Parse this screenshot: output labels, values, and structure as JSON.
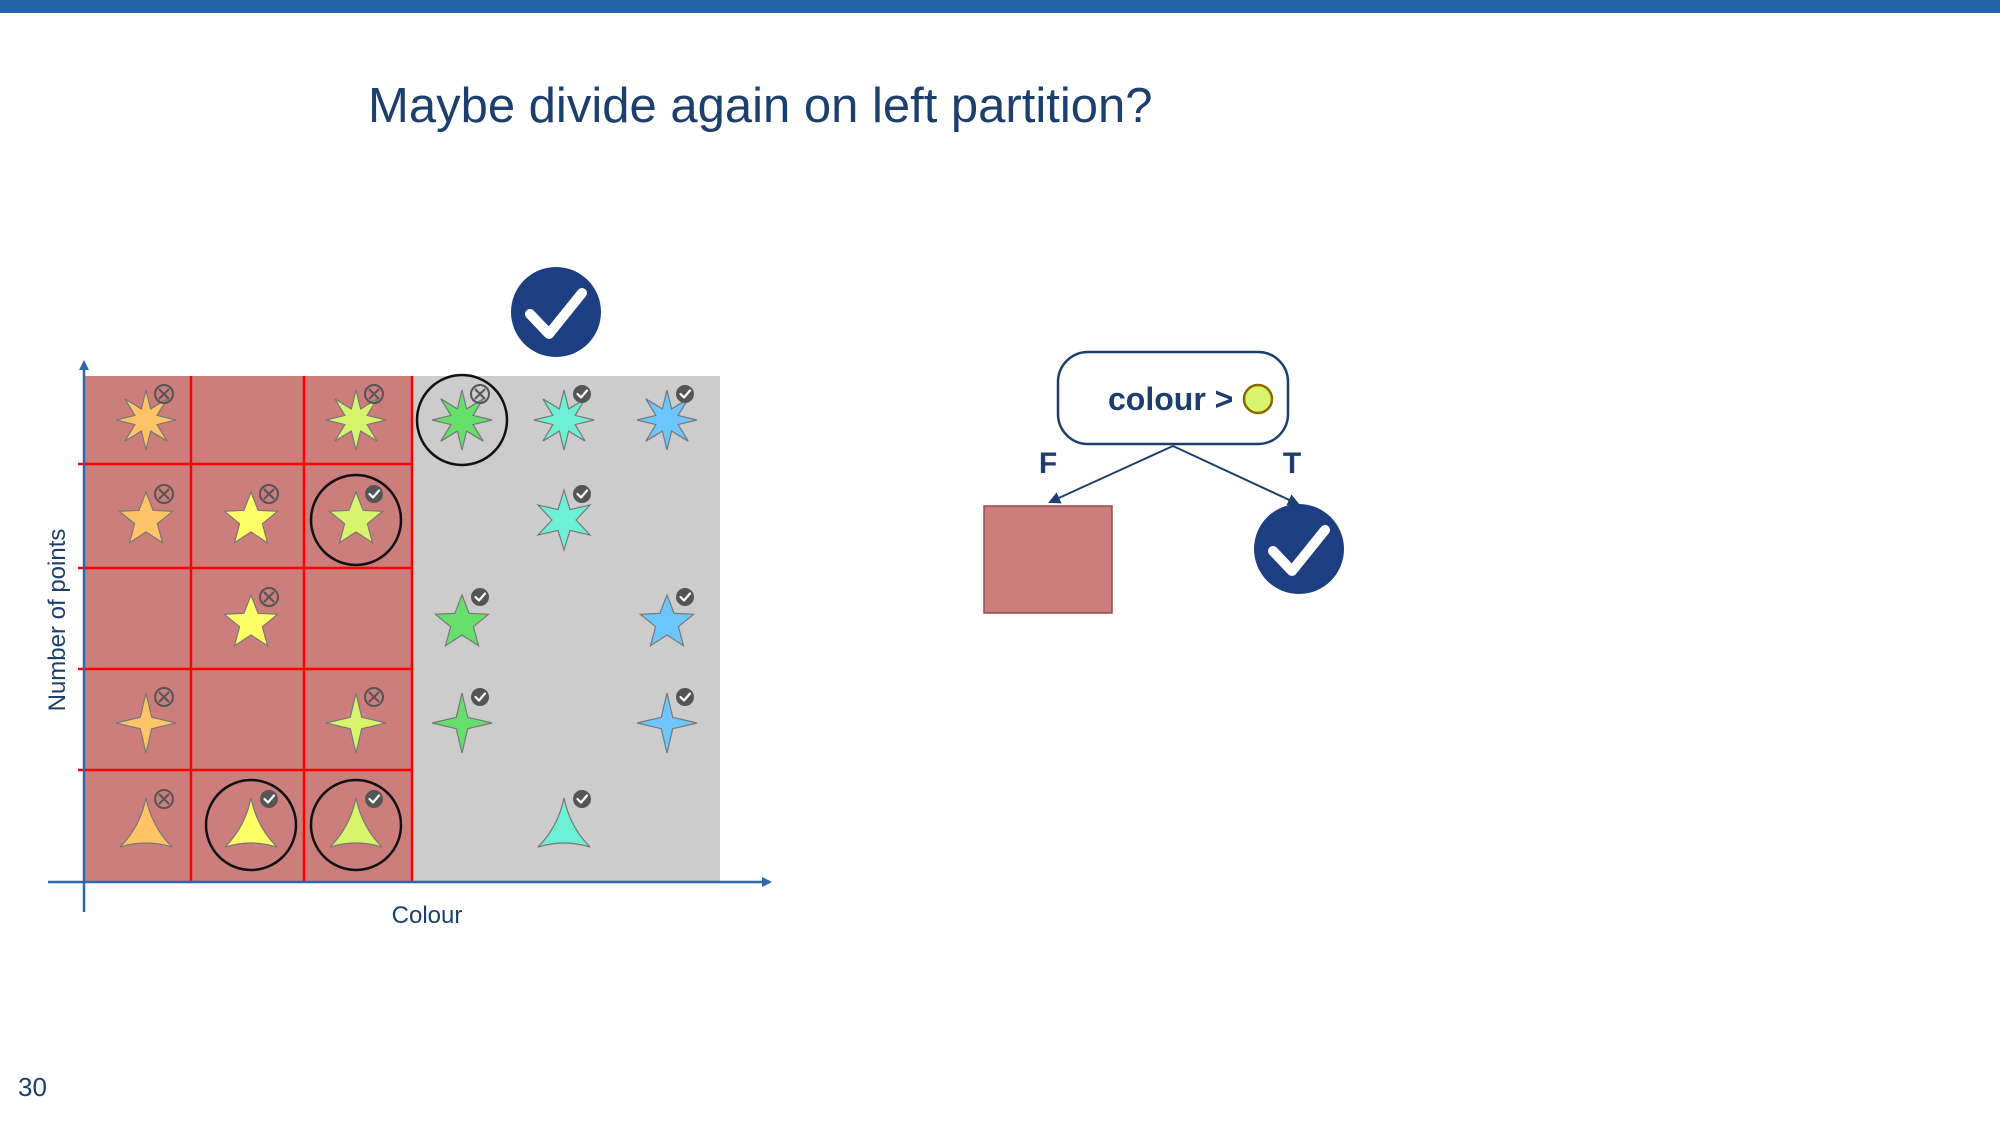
{
  "slide": {
    "title": "Maybe divide again on left partition?",
    "page_number": "30"
  },
  "plot": {
    "x_axis_label": "Colour",
    "y_axis_label": "Number of points",
    "left_region_color": "#cc7e7c",
    "right_region_color": "#cccccc",
    "split_line_color": "#ff0000",
    "items": [
      {
        "shape": "star8",
        "color": "#ffc468",
        "mark": "cross",
        "circled": false
      },
      {
        "shape": "none",
        "color": "",
        "mark": "none",
        "circled": false
      },
      {
        "shape": "star8",
        "color": "#d8f46c",
        "mark": "cross",
        "circled": false
      },
      {
        "shape": "star8",
        "color": "#66e06a",
        "mark": "cross",
        "circled": true
      },
      {
        "shape": "star8",
        "color": "#6ef0d6",
        "mark": "check",
        "circled": false
      },
      {
        "shape": "star8",
        "color": "#6ec6ff",
        "mark": "check",
        "circled": false
      },
      {
        "shape": "star5",
        "color": "#ffc468",
        "mark": "cross",
        "circled": false
      },
      {
        "shape": "star5",
        "color": "#ffff66",
        "mark": "cross",
        "circled": false
      },
      {
        "shape": "star5",
        "color": "#d8f46c",
        "mark": "check",
        "circled": true
      },
      {
        "shape": "none",
        "color": "",
        "mark": "none",
        "circled": false
      },
      {
        "shape": "star6",
        "color": "#6ef0d6",
        "mark": "check",
        "circled": false
      },
      {
        "shape": "none",
        "color": "",
        "mark": "none",
        "circled": false
      },
      {
        "shape": "none",
        "color": "",
        "mark": "none",
        "circled": false
      },
      {
        "shape": "star5",
        "color": "#ffff66",
        "mark": "cross",
        "circled": false
      },
      {
        "shape": "none",
        "color": "",
        "mark": "none",
        "circled": false
      },
      {
        "shape": "star5",
        "color": "#66e06a",
        "mark": "check",
        "circled": false
      },
      {
        "shape": "none",
        "color": "",
        "mark": "none",
        "circled": false
      },
      {
        "shape": "star5",
        "color": "#6ec6ff",
        "mark": "check",
        "circled": false
      },
      {
        "shape": "star4",
        "color": "#ffc468",
        "mark": "cross",
        "circled": false
      },
      {
        "shape": "none",
        "color": "",
        "mark": "none",
        "circled": false
      },
      {
        "shape": "star4",
        "color": "#d8f46c",
        "mark": "cross",
        "circled": false
      },
      {
        "shape": "star4",
        "color": "#66e06a",
        "mark": "check",
        "circled": false
      },
      {
        "shape": "none",
        "color": "",
        "mark": "none",
        "circled": false
      },
      {
        "shape": "star4",
        "color": "#6ec6ff",
        "mark": "check",
        "circled": false
      },
      {
        "shape": "tri",
        "color": "#ffc468",
        "mark": "cross",
        "circled": false
      },
      {
        "shape": "tri",
        "color": "#ffff66",
        "mark": "check",
        "circled": true
      },
      {
        "shape": "tri",
        "color": "#d8f46c",
        "mark": "check",
        "circled": true
      },
      {
        "shape": "none",
        "color": "",
        "mark": "none",
        "circled": false
      },
      {
        "shape": "tri",
        "color": "#6ef0d6",
        "mark": "check",
        "circled": false
      },
      {
        "shape": "none",
        "color": "",
        "mark": "none",
        "circled": false
      }
    ]
  },
  "tree": {
    "root_label": "colour >",
    "root_swatch_color": "#d8f46c",
    "false_label": "F",
    "true_label": "T",
    "false_leaf_color": "#cc7e7c",
    "badge_color": "#1d3f82"
  }
}
